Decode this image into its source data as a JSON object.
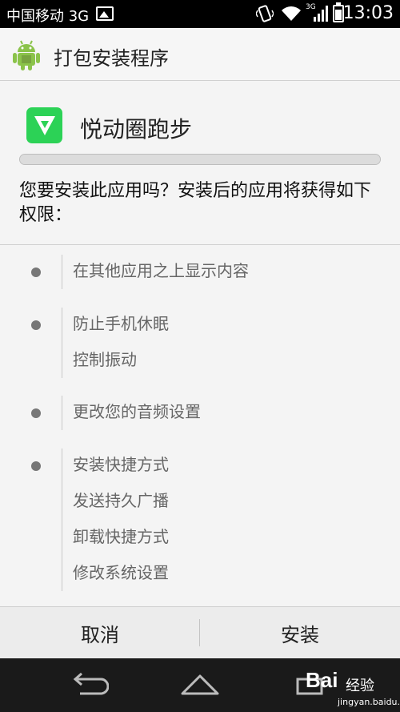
{
  "status_bar": {
    "carrier": "中国移动 3G",
    "network_type": "3G",
    "clock": "13:03",
    "battery_level": 0.75
  },
  "action_bar": {
    "title": "打包安装程序",
    "icon": "android-icon"
  },
  "app": {
    "name": "悦动圈跑步",
    "icon": "yuedongquan-app-icon",
    "icon_color": "#2cd256"
  },
  "prompt": "您要安装此应用吗？安装后的应用将获得如下权限：",
  "permission_groups": [
    {
      "items": [
        "在其他应用之上显示内容"
      ]
    },
    {
      "items": [
        "防止手机休眠",
        "控制振动"
      ]
    },
    {
      "items": [
        "更改您的音频设置"
      ]
    },
    {
      "items": [
        "安装快捷方式",
        "发送持久广播",
        "卸载快捷方式",
        "修改系统设置"
      ]
    }
  ],
  "buttons": {
    "cancel": "取消",
    "install": "安装"
  },
  "nav_bar": {
    "icons": [
      "back-icon",
      "home-icon",
      "recent-apps-icon"
    ]
  },
  "watermark": {
    "main": "Bai",
    "sub": "经验",
    "url": "jingyan.baidu.com"
  }
}
